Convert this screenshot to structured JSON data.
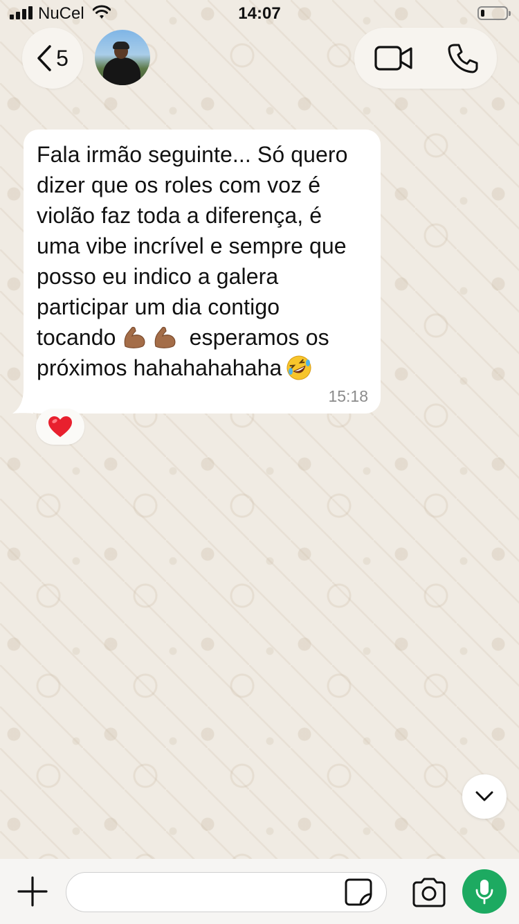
{
  "status_bar": {
    "carrier": "NuCel",
    "time": "14:07",
    "battery_level": 0.15
  },
  "header": {
    "back_count": "5",
    "icons": [
      "chevron-left-icon",
      "video-call-icon",
      "phone-icon"
    ]
  },
  "messages": [
    {
      "text_part1": "Fala irmão seguinte... Só quero\ndizer que os roles com voz é\nviolão faz toda a diferença, é\numa vibe incrível e sempre que\nposso eu indico a galera\nparticipar um dia contigo\ntocando ",
      "text_part2": " esperamos os\npróximos hahahahahaha",
      "emojis": [
        "flexed-biceps-icon",
        "flexed-biceps-icon",
        "rolling-laughing-icon"
      ],
      "time": "15:18",
      "reaction": "heart-icon"
    }
  ],
  "composer": {
    "input_value": "",
    "icons": [
      "plus-icon",
      "sticker-icon",
      "camera-icon",
      "microphone-icon"
    ]
  },
  "colors": {
    "wallpaper": "#f0ebe3",
    "bubble": "#ffffff",
    "mic_button": "#1daa61",
    "reaction_heart": "#e8202e"
  }
}
